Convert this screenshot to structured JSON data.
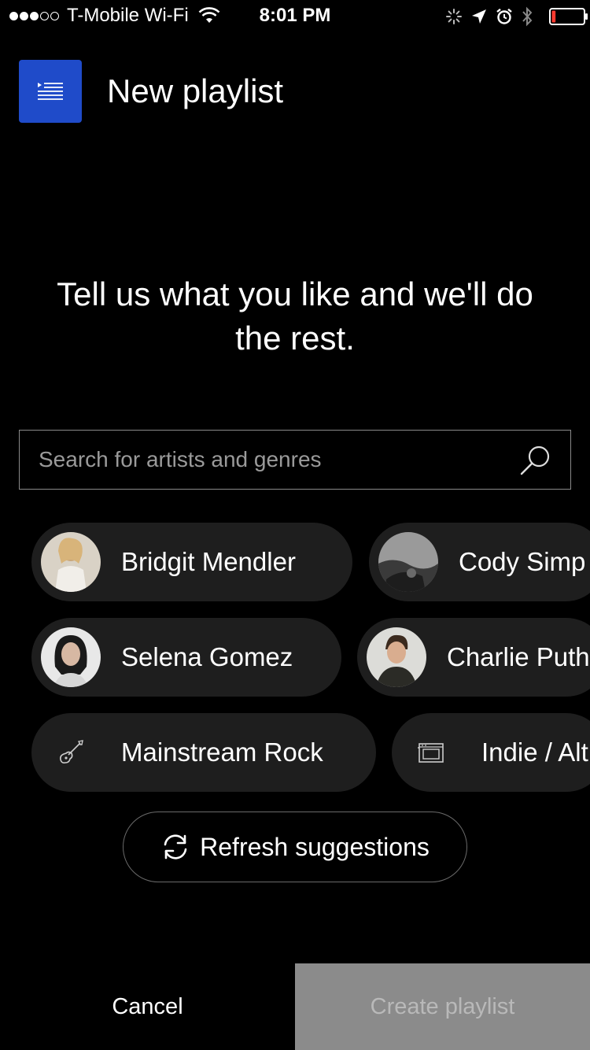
{
  "status_bar": {
    "carrier": "T-Mobile Wi-Fi",
    "time": "8:01 PM",
    "signal_bars_filled": 3,
    "signal_bars_total": 5,
    "battery_level": 0.12,
    "battery_color": "#ff3b30"
  },
  "header": {
    "title": "New playlist",
    "icon": "playlist-icon",
    "icon_bg": "#1f4bc9"
  },
  "tagline": "Tell us what you like and we'll do the rest.",
  "search": {
    "placeholder": "Search for artists and genres",
    "value": ""
  },
  "suggestions": [
    {
      "label": "Bridgit Mendler",
      "type": "artist",
      "avatar": "artist-photo-bridgit-mendler"
    },
    {
      "label": "Cody Simp",
      "type": "artist",
      "avatar": "artist-photo-cody-simpson"
    },
    {
      "label": "Selena Gomez",
      "type": "artist",
      "avatar": "artist-photo-selena-gomez"
    },
    {
      "label": "Charlie Puth",
      "type": "artist",
      "avatar": "artist-photo-charlie-puth"
    },
    {
      "label": "Mainstream Rock",
      "type": "genre",
      "icon": "guitar-icon"
    },
    {
      "label": "Indie / Alt",
      "type": "genre",
      "icon": "amplifier-icon"
    }
  ],
  "refresh_label": "Refresh suggestions",
  "footer": {
    "cancel_label": "Cancel",
    "create_label": "Create playlist",
    "create_enabled": false
  },
  "colors": {
    "background": "#000000",
    "chip_bg": "#1e1e1e",
    "create_disabled_bg": "#8b8b8b"
  }
}
